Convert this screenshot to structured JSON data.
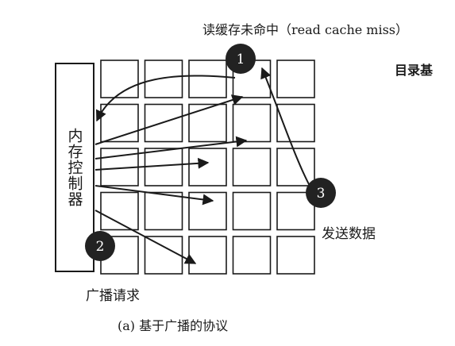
{
  "labels": {
    "read_miss": "读缓存未命中（read cache miss）",
    "directory": "目录基",
    "send_data": "发送数据",
    "broadcast_request": "广播请求",
    "memory_controller": "内存控制器",
    "caption": "(a) 基于广播的协议"
  },
  "steps": [
    {
      "num": "1"
    },
    {
      "num": "2"
    },
    {
      "num": "3"
    }
  ],
  "grid": {
    "rows": 5,
    "cols": 5
  },
  "colors": {
    "ink": "#1a1a1a",
    "badge_fill": "#222222",
    "badge_text": "#ffffff",
    "background": "#ffffff"
  }
}
